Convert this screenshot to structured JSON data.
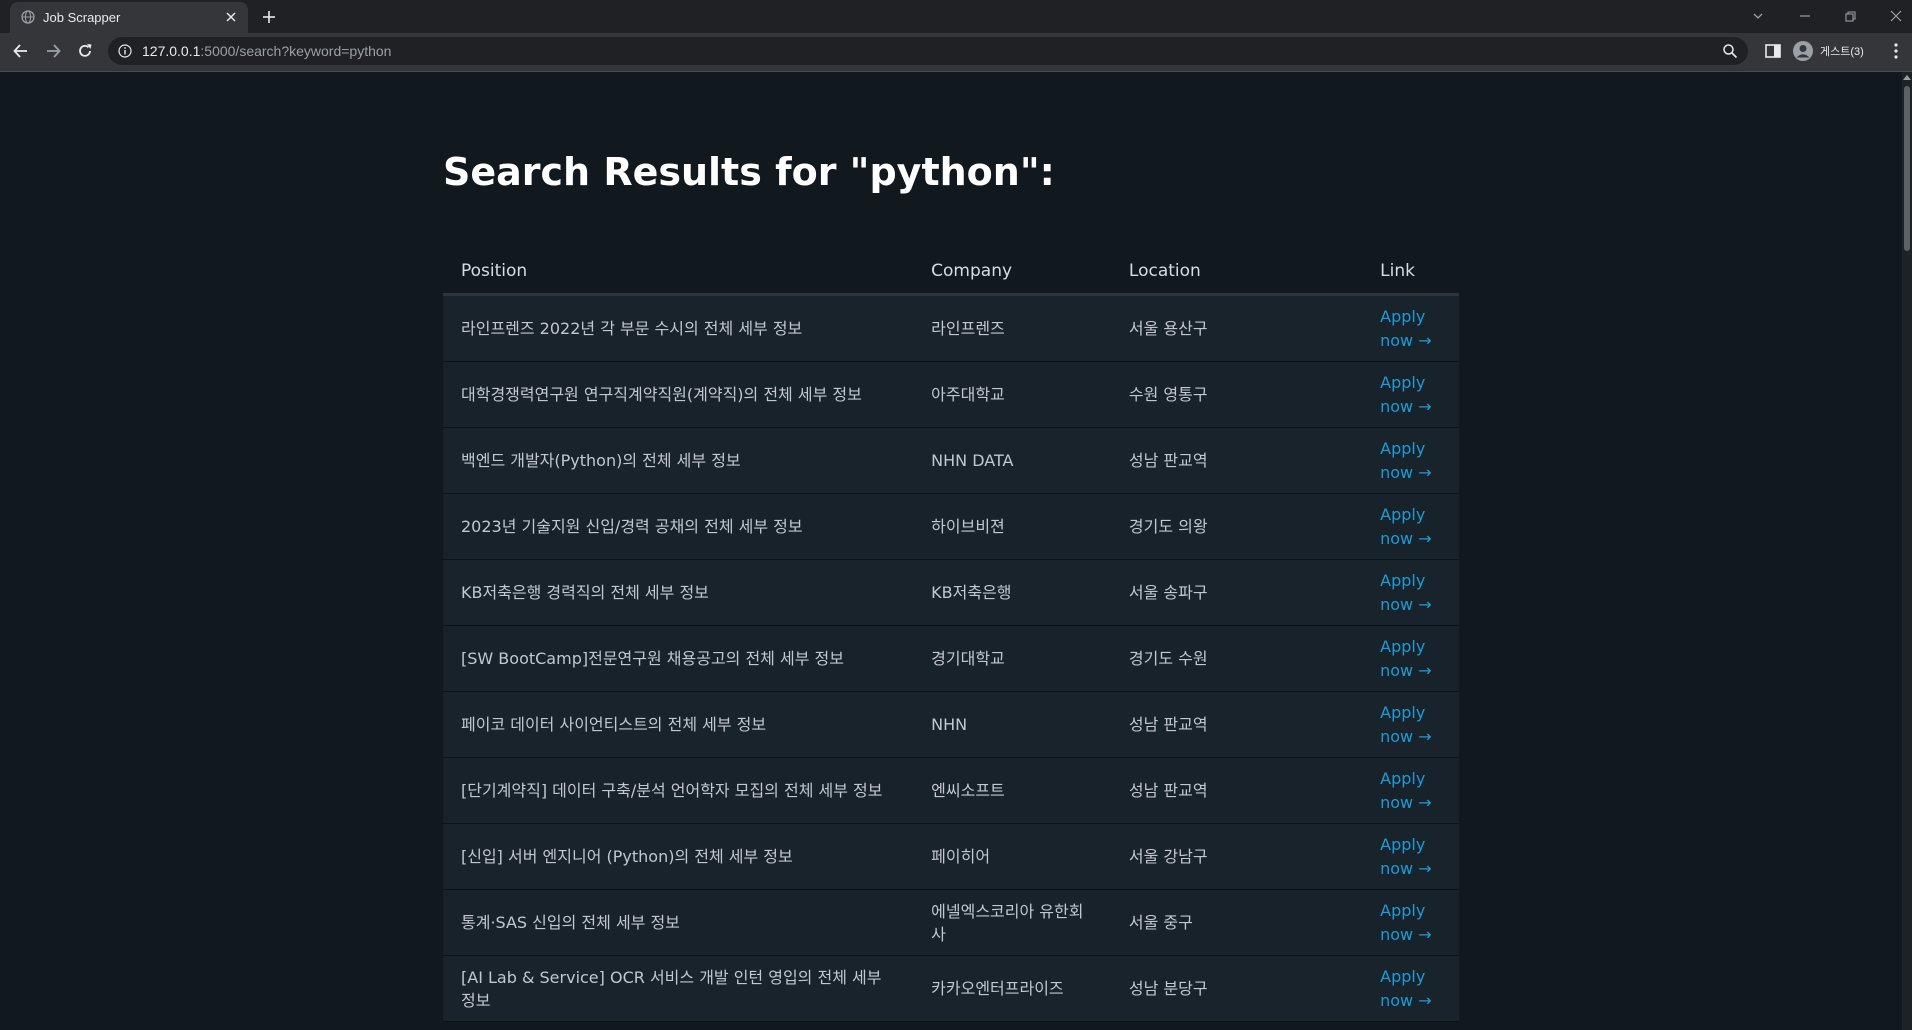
{
  "browser": {
    "tab_title": "Job Scrapper",
    "url_host": "127.0.0.1",
    "url_rest": ":5000/search?keyword=python",
    "profile_label": "게스트(3)"
  },
  "page": {
    "title": "Search Results for \"python\":",
    "headers": {
      "position": "Position",
      "company": "Company",
      "location": "Location",
      "link": "Link"
    },
    "apply_label": "Apply now →",
    "rows": [
      {
        "position": "라인프렌즈 2022년 각 부문 수시의 전체 세부 정보",
        "company": "라인프렌즈",
        "location": "서울 용산구"
      },
      {
        "position": "대학경쟁력연구원 연구직계약직원(계약직)의 전체 세부 정보",
        "company": "아주대학교",
        "location": "수원 영통구"
      },
      {
        "position": "백엔드 개발자(Python)의 전체 세부 정보",
        "company": "NHN DATA",
        "location": "성남 판교역"
      },
      {
        "position": "2023년 기술지원 신입/경력 공채의 전체 세부 정보",
        "company": "하이브비젼",
        "location": "경기도 의왕"
      },
      {
        "position": "KB저축은행 경력직의 전체 세부 정보",
        "company": "KB저축은행",
        "location": "서울 송파구"
      },
      {
        "position": "[SW BootCamp]전문연구원 채용공고의 전체 세부 정보",
        "company": "경기대학교",
        "location": "경기도 수원"
      },
      {
        "position": "페이코 데이터 사이언티스트의 전체 세부 정보",
        "company": "NHN",
        "location": "성남 판교역"
      },
      {
        "position": "[단기계약직] 데이터 구축/분석 언어학자 모집의 전체 세부 정보",
        "company": "엔씨소프트",
        "location": "성남 판교역"
      },
      {
        "position": "[신입] 서버 엔지니어 (Python)의 전체 세부 정보",
        "company": "페이히어",
        "location": "서울 강남구"
      },
      {
        "position": "통계·SAS 신입의 전체 세부 정보",
        "company": "에넬엑스코리아 유한회사",
        "location": "서울 중구"
      },
      {
        "position": "[AI Lab & Service] OCR 서비스 개발 인턴 영입의 전체 세부 정보",
        "company": "카카오엔터프라이즈",
        "location": "성남 분당구"
      }
    ]
  },
  "colors": {
    "page_bg": "#11191f",
    "row_bg": "#18222a",
    "link": "#1e9bd7",
    "chrome_bg": "#202124",
    "toolbar_bg": "#35363a"
  },
  "icons": {
    "favicon": "globe-icon",
    "tab_close": "close-icon",
    "new_tab": "plus-icon",
    "back": "arrow-left-icon",
    "forward": "arrow-right-icon",
    "reload": "reload-icon",
    "site_info": "info-icon",
    "zoom": "zoom-icon",
    "side_panel": "side-panel-icon",
    "profile": "profile-avatar-icon",
    "menu": "kebab-menu-icon"
  }
}
